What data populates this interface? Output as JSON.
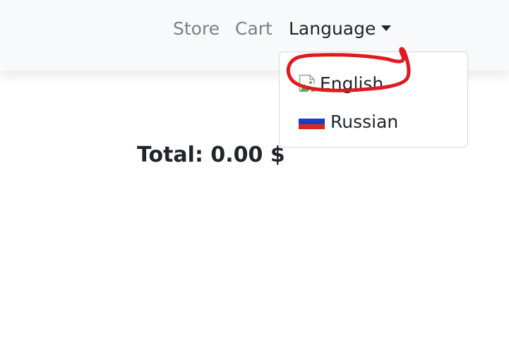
{
  "navbar": {
    "store_label": "Store",
    "cart_label": "Cart",
    "language_label": "Language"
  },
  "language_menu": {
    "items": [
      {
        "label": "English",
        "icon": "broken-image-icon"
      },
      {
        "label": "Russian",
        "icon": "russia-flag-icon"
      }
    ]
  },
  "cart": {
    "total_label": "Total: 0.00 $"
  },
  "colors": {
    "navbar_bg": "#f8f9fa",
    "nav_link": "#7b8086",
    "annotation": "#e0191f"
  }
}
